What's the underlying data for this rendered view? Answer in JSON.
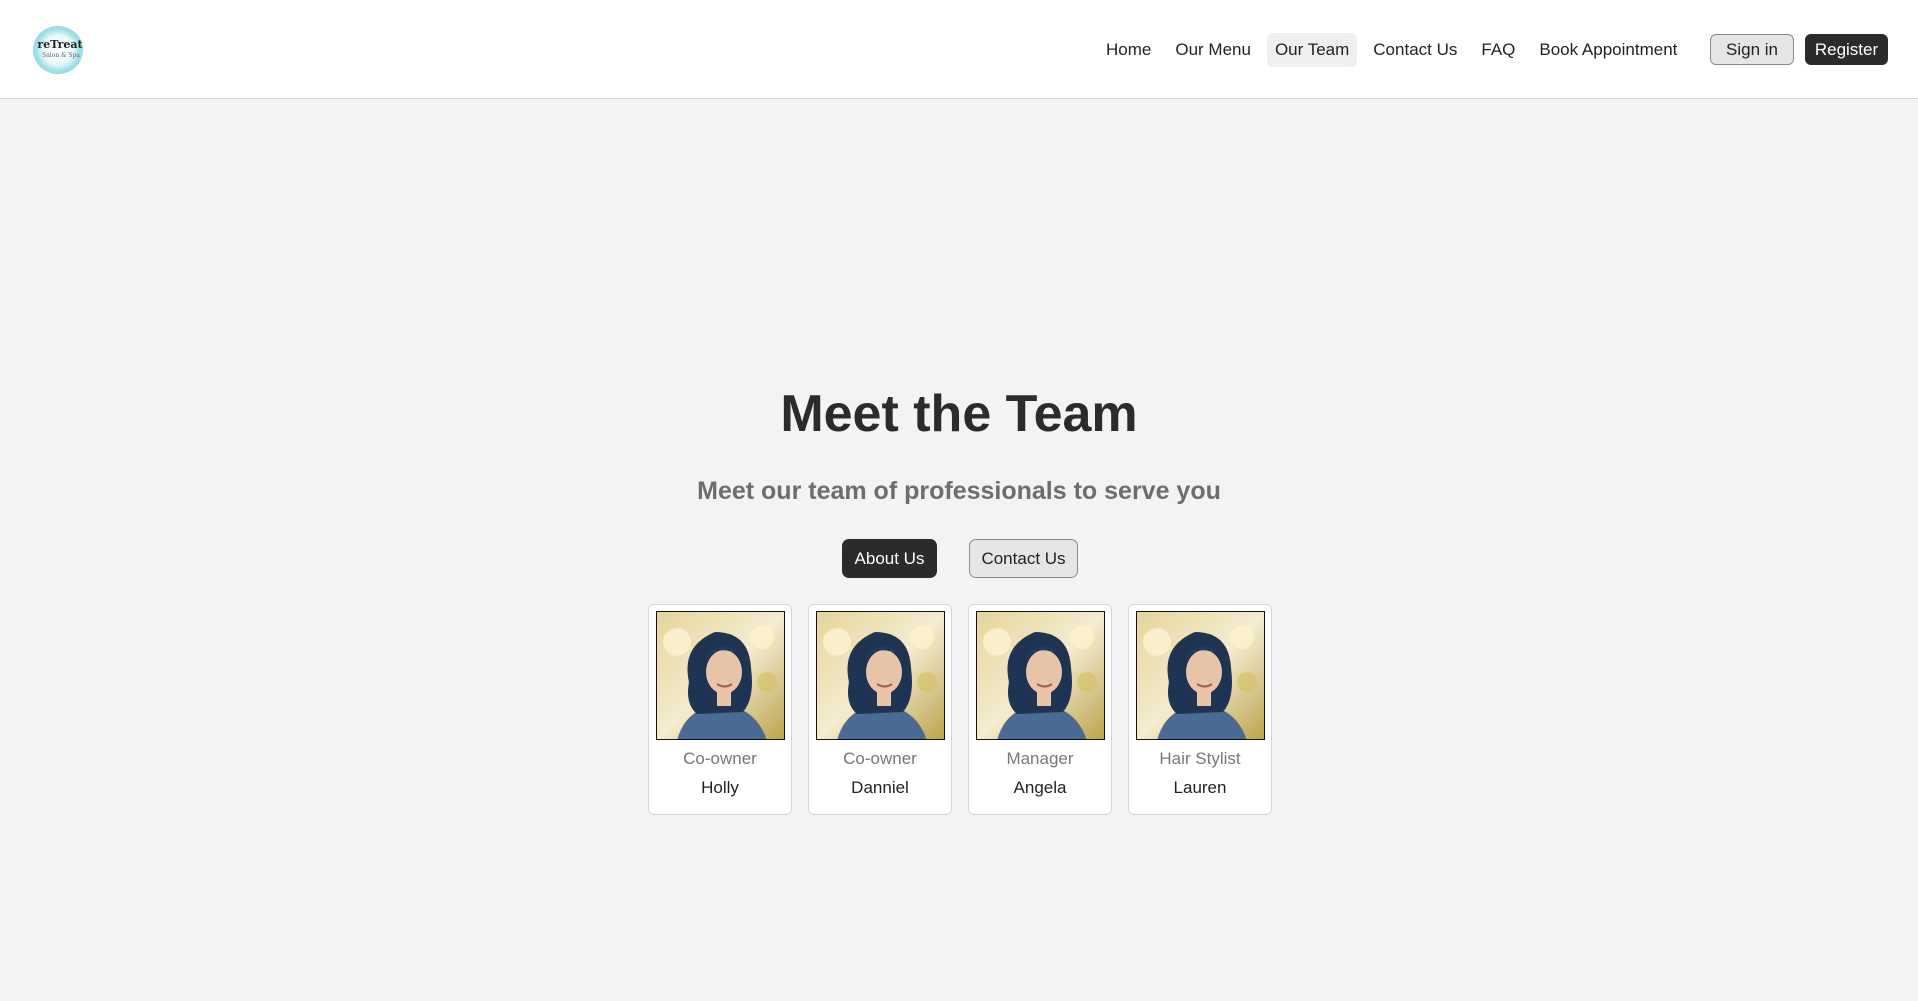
{
  "logo": {
    "title": "reTreat",
    "tagline": "Salon & Spa"
  },
  "nav": {
    "items": [
      {
        "label": "Home"
      },
      {
        "label": "Our Menu"
      },
      {
        "label": "Our Team"
      },
      {
        "label": "Contact Us"
      },
      {
        "label": "FAQ"
      },
      {
        "label": "Book Appointment"
      }
    ],
    "active": "Our Team",
    "signin_label": "Sign in",
    "register_label": "Register"
  },
  "hero": {
    "title": "Meet the Team",
    "subtitle": "Meet our team of professionals to serve you",
    "primary_button": "About Us",
    "secondary_button": "Contact Us"
  },
  "team": [
    {
      "role": "Co-owner",
      "name": "Holly"
    },
    {
      "role": "Co-owner",
      "name": "Danniel"
    },
    {
      "role": "Manager",
      "name": "Angela"
    },
    {
      "role": "Hair Stylist",
      "name": "Lauren"
    }
  ],
  "colors": {
    "page_background": "#f3f3f3",
    "header_background": "#ffffff",
    "primary_button": "#2b2b2b",
    "secondary_button": "#e5e5e5",
    "logo_accent": "#7fd3e0"
  }
}
